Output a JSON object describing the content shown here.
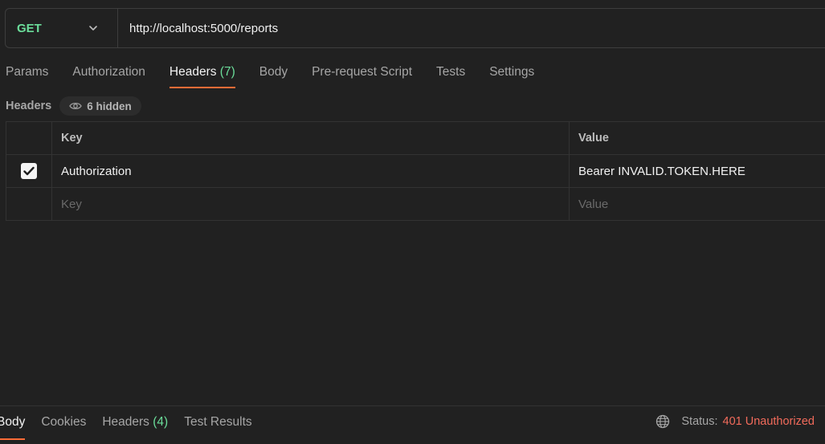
{
  "request": {
    "method": "GET",
    "url": "http://localhost:5000/reports"
  },
  "tabs": [
    {
      "label": "Params"
    },
    {
      "label": "Authorization"
    },
    {
      "label": "Headers",
      "count": "(7)",
      "active": true
    },
    {
      "label": "Body"
    },
    {
      "label": "Pre-request Script"
    },
    {
      "label": "Tests"
    },
    {
      "label": "Settings"
    }
  ],
  "headers_section": {
    "title": "Headers",
    "hidden_label": "6 hidden"
  },
  "table": {
    "columns": {
      "key": "Key",
      "value": "Value"
    },
    "rows": [
      {
        "checked": true,
        "key": "Authorization",
        "value": "Bearer INVALID.TOKEN.HERE"
      }
    ],
    "placeholder": {
      "key": "Key",
      "value": "Value"
    }
  },
  "response": {
    "tabs": [
      {
        "label": "Body",
        "active": true
      },
      {
        "label": "Cookies"
      },
      {
        "label": "Headers",
        "count": "(4)"
      },
      {
        "label": "Test Results"
      }
    ],
    "status_label": "Status:",
    "status_value": "401 Unauthorized"
  },
  "colors": {
    "accent": "#ff6c37",
    "method_get": "#6bdd9a",
    "error": "#f26b5b"
  }
}
